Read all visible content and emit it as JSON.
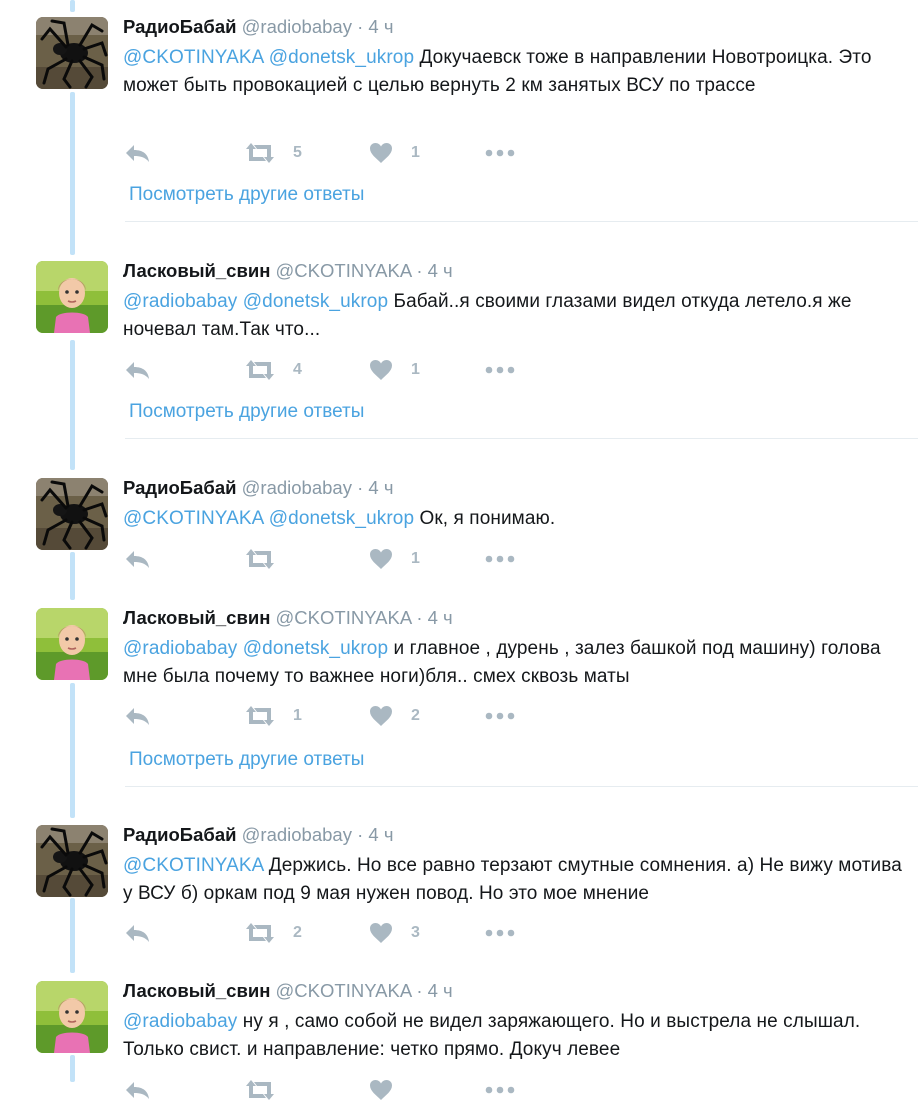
{
  "colors": {
    "link": "#4aa3e0",
    "muted": "#8899a6",
    "action_icon": "#aab8c2",
    "thread_line": "#c2e2f8",
    "separator": "#e6ecf0"
  },
  "show_more_label": "Посмотреть другие ответы",
  "tweets": [
    {
      "fullname": "РадиоБабай",
      "handle": "@radiobabay",
      "dot": "·",
      "time": "4 ч",
      "avatar": "spider-avatar",
      "mentions": "@CKOTINYAKA @donetsk_ukrop",
      "body": " Докучаевск тоже в направлении Новотроицка. Это может быть провокацией с целью вернуть 2 км занятых ВСУ по трассе",
      "retweets": "5",
      "likes": "1",
      "show_more": true
    },
    {
      "fullname": "Ласковый_свин",
      "handle": "@CKOTINYAKA",
      "dot": "·",
      "time": "4 ч",
      "avatar": "girl-avatar",
      "mentions": "@radiobabay @donetsk_ukrop",
      "body": " Бабай..я своими глазами видел откуда летело.я же ночевал там.Так что...",
      "retweets": "4",
      "likes": "1",
      "show_more": true
    },
    {
      "fullname": "РадиоБабай",
      "handle": "@radiobabay",
      "dot": "·",
      "time": "4 ч",
      "avatar": "spider-avatar",
      "mentions": "@CKOTINYAKA @donetsk_ukrop",
      "body": " Ок, я понимаю.",
      "retweets": "",
      "likes": "1",
      "show_more": false
    },
    {
      "fullname": "Ласковый_свин",
      "handle": "@CKOTINYAKA",
      "dot": "·",
      "time": "4 ч",
      "avatar": "girl-avatar",
      "mentions": "@radiobabay @donetsk_ukrop",
      "body": " и главное , дурень , залез башкой под машину) голова мне была почему то важнее ноги)бля.. смех сквозь маты",
      "retweets": "1",
      "likes": "2",
      "show_more": true
    },
    {
      "fullname": "РадиоБабай",
      "handle": "@radiobabay",
      "dot": "·",
      "time": "4 ч",
      "avatar": "spider-avatar",
      "mentions": "@CKOTINYAKA",
      "body": "  Держись. Но все равно терзают смутные сомнения. а) Не вижу мотива у ВСУ б) оркам под 9 мая нужен повод. Но это мое мнение",
      "retweets": "2",
      "likes": "3",
      "show_more": false
    },
    {
      "fullname": "Ласковый_свин",
      "handle": "@CKOTINYAKA",
      "dot": "·",
      "time": "4 ч",
      "avatar": "girl-avatar",
      "mentions": "@radiobabay",
      "body": " ну я , само собой не видел заряжающего. Но и выстрела не слышал. Только свист. и направление: четко прямо. Докуч левее",
      "retweets": "",
      "likes": "",
      "show_more": false
    }
  ]
}
